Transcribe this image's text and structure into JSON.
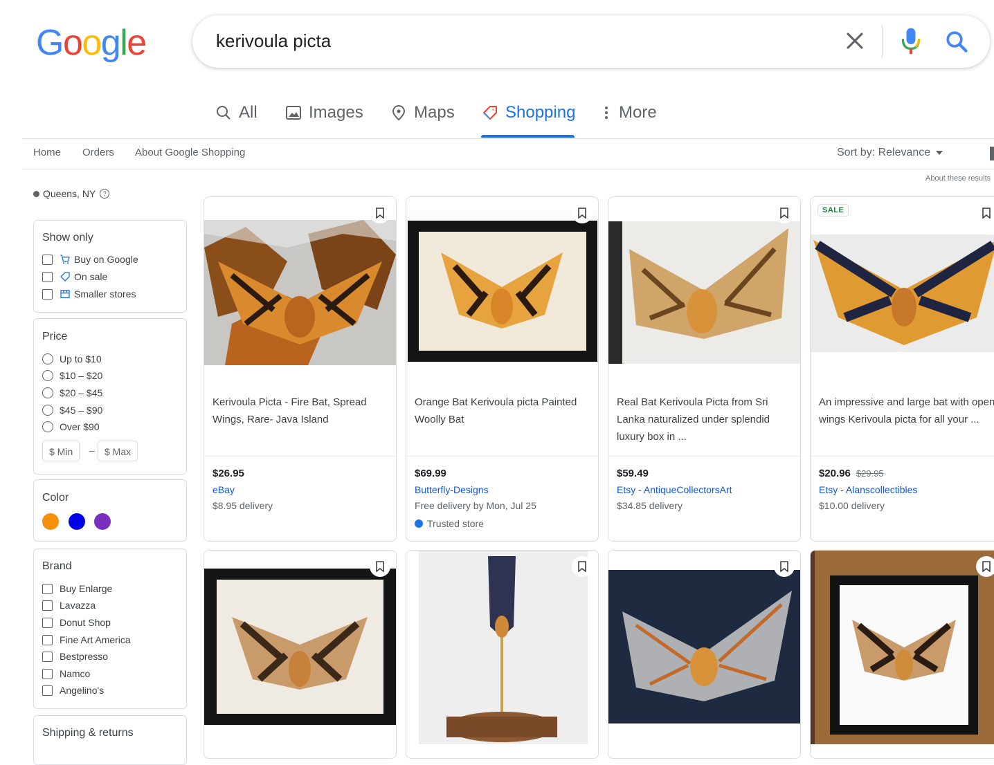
{
  "logo": {
    "letters": [
      "G",
      "o",
      "o",
      "g",
      "l",
      "e"
    ]
  },
  "search": {
    "query": "kerivoula picta"
  },
  "tabs": [
    {
      "label": "All",
      "icon": "search-icon"
    },
    {
      "label": "Images",
      "icon": "image-icon"
    },
    {
      "label": "Maps",
      "icon": "map-pin-icon"
    },
    {
      "label": "Shopping",
      "icon": "tag-icon",
      "active": true
    },
    {
      "label": "More",
      "icon": "more-vert-icon"
    }
  ],
  "subnav": {
    "items": [
      "Home",
      "Orders",
      "About Google Shopping"
    ],
    "sort": "Sort by: Relevance",
    "about_results": "About these results"
  },
  "location": {
    "label": "Queens, NY",
    "help": "?"
  },
  "filters": {
    "show_only": {
      "title": "Show only",
      "options": [
        "Buy on Google",
        "On sale",
        "Smaller stores"
      ]
    },
    "price": {
      "title": "Price",
      "options": [
        "Up to $10",
        "$10 – $20",
        "$20 – $45",
        "$45 – $90",
        "Over $90"
      ],
      "min_placeholder": "$ Min",
      "max_placeholder": "$ Max",
      "dash": "–"
    },
    "color": {
      "title": "Color",
      "swatches": [
        "#f5900c",
        "#0000ee",
        "#7b2fbe"
      ]
    },
    "brand": {
      "title": "Brand",
      "options": [
        "Buy Enlarge",
        "Lavazza",
        "Donut Shop",
        "Fine Art America",
        "Bestpresso",
        "Namco",
        "Angelino's"
      ]
    },
    "shipping": {
      "title": "Shipping & returns"
    }
  },
  "products": [
    {
      "title": "Kerivoula Picta - Fire Bat, Spread Wings, Rare- Java Island",
      "price": "$26.95",
      "store": "eBay",
      "delivery": "$8.95 delivery"
    },
    {
      "title": "Orange Bat Kerivoula picta Painted Woolly Bat",
      "price": "$69.99",
      "store": "Butterfly-Designs",
      "delivery": "Free delivery by Mon, Jul 25",
      "trusted": "Trusted store"
    },
    {
      "title": "Real Bat Kerivoula Picta from Sri Lanka naturalized under splendid luxury box in ...",
      "price": "$59.49",
      "store": "Etsy - AntiqueCollectorsArt",
      "delivery": "$34.85 delivery"
    },
    {
      "title": "An impressive and large bat with open wings Kerivoula picta for all your ...",
      "price": "$20.96",
      "old_price": "$29.95",
      "store": "Etsy - Alanscollectibles",
      "delivery": "$10.00 delivery",
      "badge": "SALE"
    }
  ],
  "colors": {
    "accent": "#1a73e8",
    "link": "#1558d6",
    "sale": "#188038"
  }
}
